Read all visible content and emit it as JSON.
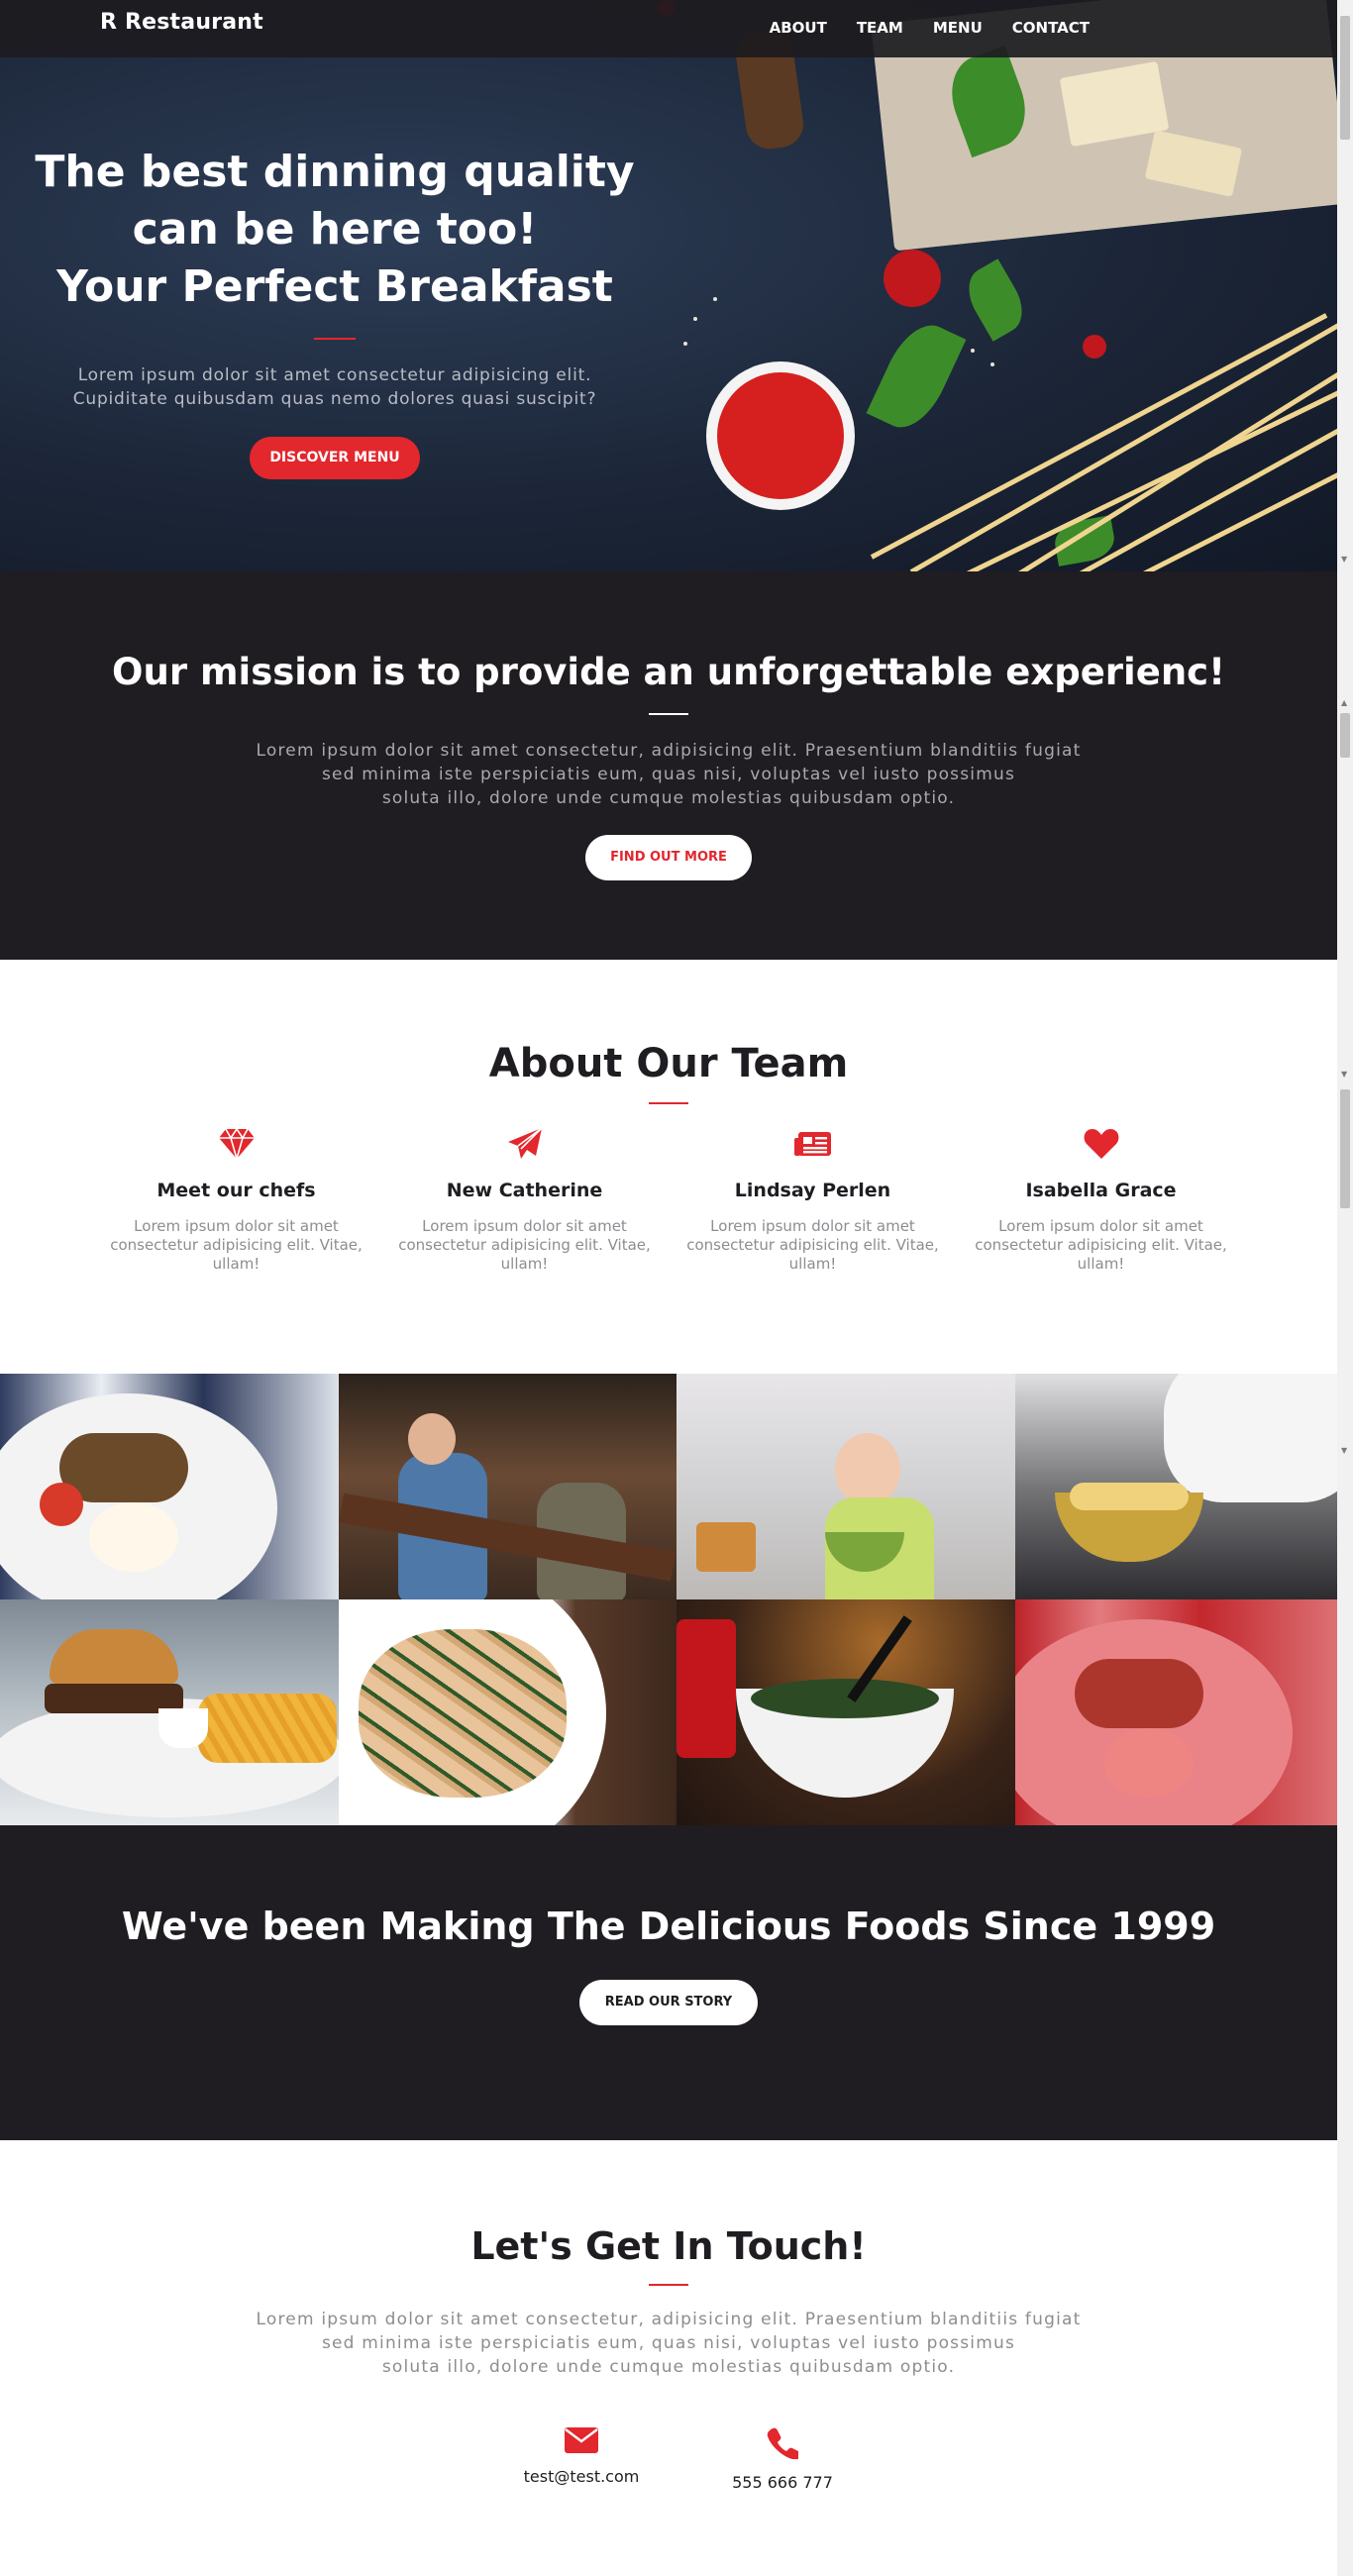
{
  "nav": {
    "brand": "R Restaurant",
    "links": [
      "ABOUT",
      "TEAM",
      "MENU",
      "CONTACT"
    ]
  },
  "hero": {
    "title_lines": [
      "The best dinning quality",
      "can be here too!",
      "Your Perfect Breakfast"
    ],
    "subtitle_lines": [
      "Lorem ipsum dolor sit amet consectetur adipisicing elit.",
      "Cupiditate quibusdam quas nemo dolores quasi suscipit?"
    ],
    "cta": "DISCOVER MENU"
  },
  "mission": {
    "title": "Our mission is to provide an unforgettable experienc!",
    "text_lines": [
      "Lorem ipsum dolor sit amet consectetur, adipisicing elit. Praesentium blanditiis fugiat",
      "sed minima iste perspiciatis eum, quas nisi, voluptas vel iusto possimus",
      "soluta illo, dolore unde cumque molestias quibusdam optio."
    ],
    "cta": "FIND OUT MORE"
  },
  "team": {
    "title": "About Our Team",
    "members": [
      {
        "icon": "diamond-icon",
        "name": "Meet our chefs",
        "desc": "Lorem ipsum dolor sit amet consectetur adipisicing elit. Vitae, ullam!"
      },
      {
        "icon": "paper-plane-icon",
        "name": "New Catherine",
        "desc": "Lorem ipsum dolor sit amet consectetur adipisicing elit. Vitae, ullam!"
      },
      {
        "icon": "newspaper-icon",
        "name": "Lindsay Perlen",
        "desc": "Lorem ipsum dolor sit amet consectetur adipisicing elit. Vitae, ullam!"
      },
      {
        "icon": "heart-icon",
        "name": "Isabella Grace",
        "desc": "Lorem ipsum dolor sit amet consectetur adipisicing elit. Vitae, ullam!"
      }
    ]
  },
  "gallery": {
    "tiles": [
      "breakfast-plate",
      "restaurant-bar",
      "girl-with-salad",
      "chef-cooking-pasta",
      "burger-and-fries",
      "pasta-dish",
      "salad-bowl-and-soda",
      "breakfast-plate-red-tint"
    ]
  },
  "story": {
    "title": "We've been Making The Delicious Foods Since 1999",
    "cta": "READ OUR STORY"
  },
  "contact": {
    "title": "Let's Get In Touch!",
    "text_lines": [
      "Lorem ipsum dolor sit amet consectetur, adipisicing elit. Praesentium blanditiis fugiat",
      "sed minima iste perspiciatis eum, quas nisi, voluptas vel iusto possimus",
      "soluta illo, dolore unde cumque molestias quibusdam optio."
    ],
    "email": "test@test.com",
    "phone": "555 666 777",
    "email_icon": "envelope-icon",
    "phone_icon": "phone-icon"
  },
  "colors": {
    "accent": "#e2272d",
    "dark": "#1f1d21",
    "white": "#ffffff",
    "muted": "#8d8d92"
  }
}
